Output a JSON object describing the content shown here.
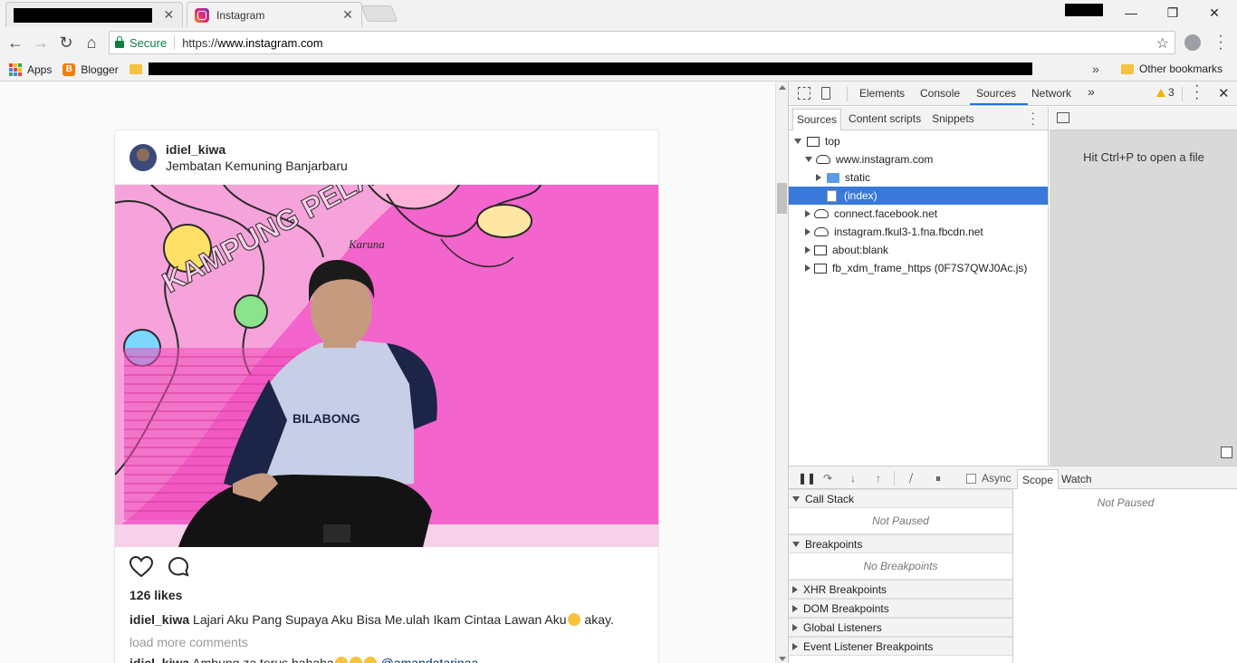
{
  "browser": {
    "tabs": [
      {
        "title": "",
        "redacted": true
      },
      {
        "title": "Instagram",
        "active": true
      }
    ],
    "close_glyph": "✕",
    "window_controls": {
      "minimize": "—",
      "maximize": "❐",
      "close": "✕"
    },
    "nav": {
      "back": "←",
      "forward": "→",
      "reload": "↻",
      "home": "⌂"
    },
    "security_label": "Secure",
    "url_scheme": "https://",
    "url_host": "www.instagram.com",
    "star_glyph": "☆",
    "bookmarks": {
      "apps": "Apps",
      "blogger": "Blogger",
      "more_glyph": "»",
      "other": "Other bookmarks"
    }
  },
  "post": {
    "username": "idiel_kiwa",
    "location": "Jembatan Kemuning Banjarbaru",
    "likes": "126 likes",
    "caption_user": "idiel_kiwa",
    "caption_text": "Lajari Aku Pang Supaya Aku Bisa Me.ulah Ikam Cintaa Lawan Aku",
    "caption_tail": " akay.",
    "load_more": "load more comments",
    "comment_user": "idiel_kiwa",
    "comment_text": "Ambung za terus hahaha",
    "comment_mention": "@amandatarinaa",
    "photo_text": {
      "wall_text": "KAMPUNG PELANGI",
      "shirt_text": "BILABONG",
      "wall_signature": "Karuna"
    }
  },
  "devtools": {
    "tabs": [
      "Elements",
      "Console",
      "Sources",
      "Network"
    ],
    "active_tab": "Sources",
    "more_tabs": "»",
    "warning_count": "3",
    "navigator_tabs": [
      "Sources",
      "Content scripts",
      "Snippets"
    ],
    "tree": [
      {
        "label": "top",
        "depth": 0,
        "icon": "frame",
        "expanded": true
      },
      {
        "label": "www.instagram.com",
        "depth": 1,
        "icon": "cloud",
        "expanded": true
      },
      {
        "label": "static",
        "depth": 2,
        "icon": "folder",
        "expanded": false
      },
      {
        "label": "(index)",
        "depth": 2,
        "icon": "file",
        "selected": true
      },
      {
        "label": "connect.facebook.net",
        "depth": 1,
        "icon": "cloud",
        "expanded": false
      },
      {
        "label": "instagram.fkul3-1.fna.fbcdn.net",
        "depth": 1,
        "icon": "cloud",
        "expanded": false
      },
      {
        "label": "about:blank",
        "depth": 1,
        "icon": "frame",
        "expanded": false
      },
      {
        "label": "fb_xdm_frame_https (0F7S7QWJ0Ac.js)",
        "depth": 1,
        "icon": "frame",
        "expanded": false
      }
    ],
    "editor_hint": "Hit Ctrl+P to open a file",
    "async_label": "Async",
    "call_stack": {
      "title": "Call Stack",
      "body": "Not Paused"
    },
    "breakpoints": {
      "title": "Breakpoints",
      "body": "No Breakpoints"
    },
    "collapsed_panes": [
      "XHR Breakpoints",
      "DOM Breakpoints",
      "Global Listeners",
      "Event Listener Breakpoints"
    ],
    "scope_tabs": [
      "Scope",
      "Watch"
    ],
    "scope_body": "Not Paused"
  }
}
